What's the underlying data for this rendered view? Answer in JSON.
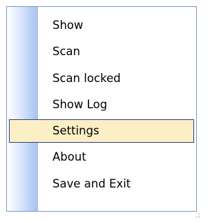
{
  "context_menu": {
    "items": [
      {
        "label": "Show",
        "selected": false
      },
      {
        "label": "Scan",
        "selected": false
      },
      {
        "label": "Scan locked",
        "selected": false
      },
      {
        "label": "Show Log",
        "selected": false
      },
      {
        "label": "Settings",
        "selected": true
      },
      {
        "label": "About",
        "selected": false
      },
      {
        "label": "Save and Exit",
        "selected": false
      }
    ]
  },
  "colors": {
    "menu_border": "#7a96c8",
    "highlight_fill": "#fcefc6",
    "highlight_border": "#2b3e7a",
    "gutter_gradient_end": "#a7c0ec"
  }
}
